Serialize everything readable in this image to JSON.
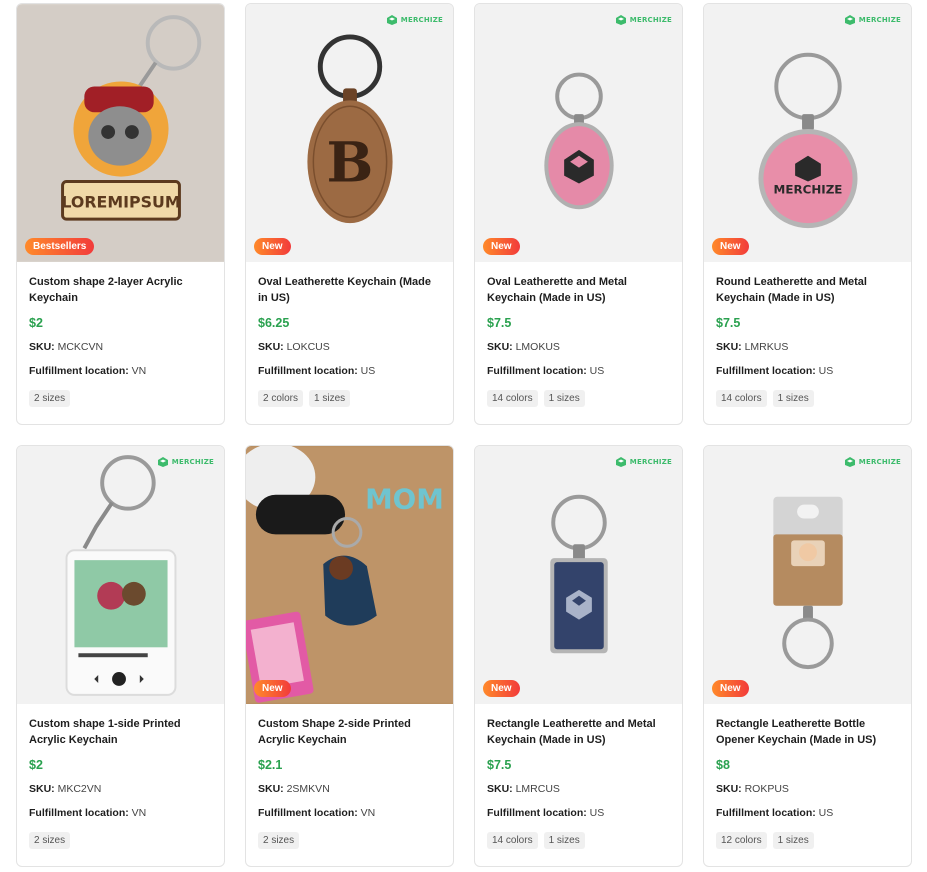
{
  "brand": {
    "logo_text": "MERCHIZE",
    "accent": "#3dbb6c",
    "price_color": "#2aa14f"
  },
  "products": [
    {
      "title": "Custom shape 2-layer Acrylic Keychain",
      "price": "$2",
      "sku_label": "SKU:",
      "sku": "MCKCVN",
      "location_label": "Fulfillment location:",
      "location": "VN",
      "badge": "Bestsellers",
      "tags": [
        "2 sizes"
      ],
      "image": "acrylic-cat-keychain-photo"
    },
    {
      "title": "Oval Leatherette Keychain (Made in US)",
      "price": "$6.25",
      "sku_label": "SKU:",
      "sku": "LOKCUS",
      "location_label": "Fulfillment location:",
      "location": "US",
      "badge": "New",
      "tags": [
        "2 colors",
        "1 sizes"
      ],
      "image": "oval-leather-keychain"
    },
    {
      "title": "Oval Leatherette and Metal Keychain (Made in US)",
      "price": "$7.5",
      "sku_label": "SKU:",
      "sku": "LMOKUS",
      "location_label": "Fulfillment location:",
      "location": "US",
      "badge": "New",
      "tags": [
        "14 colors",
        "1 sizes"
      ],
      "image": "oval-metal-keychain"
    },
    {
      "title": "Round Leatherette and Metal Keychain (Made in US)",
      "price": "$7.5",
      "sku_label": "SKU:",
      "sku": "LMRKUS",
      "location_label": "Fulfillment location:",
      "location": "US",
      "badge": "New",
      "tags": [
        "14 colors",
        "1 sizes"
      ],
      "image": "round-metal-keychain",
      "image_text": "MERCHIZE"
    },
    {
      "title": "Custom shape 1-side Printed Acrylic Keychain",
      "price": "$2",
      "sku_label": "SKU:",
      "sku": "MKC2VN",
      "location_label": "Fulfillment location:",
      "location": "VN",
      "badge": "",
      "tags": [
        "2 sizes"
      ],
      "image": "printed-acrylic-keychain"
    },
    {
      "title": "Custom Shape 2-side Printed Acrylic Keychain",
      "price": "$2.1",
      "sku_label": "SKU:",
      "sku": "2SMKVN",
      "location_label": "Fulfillment location:",
      "location": "VN",
      "badge": "New",
      "tags": [
        "2 sizes"
      ],
      "image": "mom-keychain-photo"
    },
    {
      "title": "Rectangle Leatherette and Metal Keychain (Made in US)",
      "price": "$7.5",
      "sku_label": "SKU:",
      "sku": "LMRCUS",
      "location_label": "Fulfillment location:",
      "location": "US",
      "badge": "New",
      "tags": [
        "14 colors",
        "1 sizes"
      ],
      "image": "rectangle-metal-keychain"
    },
    {
      "title": "Rectangle Leatherette Bottle Opener Keychain (Made in US)",
      "price": "$8",
      "sku_label": "SKU:",
      "sku": "ROKPUS",
      "location_label": "Fulfillment location:",
      "location": "US",
      "badge": "New",
      "tags": [
        "12 colors",
        "1 sizes"
      ],
      "image": "bottle-opener-keychain"
    }
  ]
}
